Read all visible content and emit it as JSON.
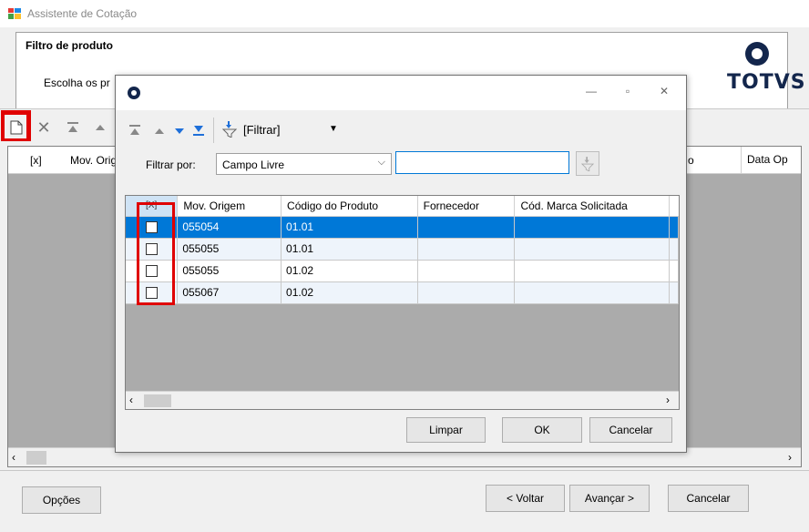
{
  "window": {
    "title": "Assistente de Cotação"
  },
  "header": {
    "title": "Filtro de produto",
    "description": "Escolha os pr",
    "logo_text": "TOTVS"
  },
  "main_grid": {
    "columns": [
      "[x]",
      "Mov. Orig",
      "o",
      "Data Op"
    ]
  },
  "footer": {
    "options_label": "Opções",
    "back_label": "< Voltar",
    "next_label": "Avançar >",
    "cancel_label": "Cancelar"
  },
  "dialog": {
    "toolbar": {
      "filter_label": "[Filtrar]"
    },
    "filter": {
      "label": "Filtrar por:",
      "selected": "Campo Livre",
      "value": ""
    },
    "columns": [
      "[X]",
      "Mov. Origem",
      "Código do Produto",
      "Fornecedor",
      "Cód. Marca Solicitada"
    ],
    "rows": [
      {
        "mov_origem": "055054",
        "codigo": "01.01",
        "fornecedor": "",
        "marca": "",
        "selected": true
      },
      {
        "mov_origem": "055055",
        "codigo": "01.01",
        "fornecedor": "",
        "marca": "",
        "selected": false
      },
      {
        "mov_origem": "055055",
        "codigo": "01.02",
        "fornecedor": "",
        "marca": "",
        "selected": false
      },
      {
        "mov_origem": "055067",
        "codigo": "01.02",
        "fornecedor": "",
        "marca": "",
        "selected": false
      }
    ],
    "buttons": {
      "clear": "Limpar",
      "ok": "OK",
      "cancel": "Cancelar"
    }
  },
  "colors": {
    "selection": "#0078d7",
    "highlight": "#e00000",
    "brand": "#13264c"
  }
}
